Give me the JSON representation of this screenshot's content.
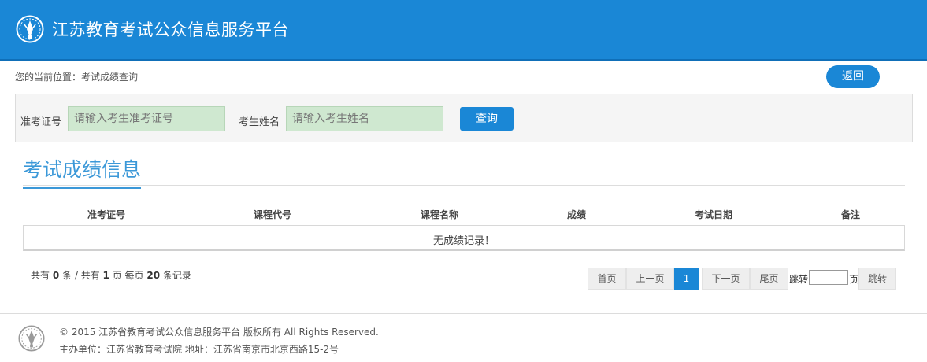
{
  "header": {
    "title": "江苏教育考试公众信息服务平台",
    "logo_icon": "emblem-icon",
    "color": "#1a87d6"
  },
  "breadcrumb": "您的当前位置：考试成绩查询",
  "back_label": "返回",
  "search": {
    "ticket_label": "准考证号",
    "ticket_placeholder": "请输入考生准考证号",
    "ticket_value": "",
    "name_label": "考生姓名",
    "name_placeholder": "请输入考生姓名",
    "name_value": "",
    "query_label": "查询"
  },
  "section_title": "考试成绩信息",
  "table": {
    "columns": [
      "准考证号",
      "课程代号",
      "课程名称",
      "成绩",
      "考试日期",
      "备注"
    ],
    "rows": [],
    "empty_message": "无成绩记录！"
  },
  "summary": {
    "prefix": "共有",
    "total_records": "0",
    "records_unit": "条 / 共有",
    "total_pages": "1",
    "pages_unit": "页 每页",
    "page_size": "20",
    "suffix": "条记录"
  },
  "pagination": {
    "first": "首页",
    "prev": "上一页",
    "current": "1",
    "next": "下一页",
    "last": "尾页",
    "jump_prefix": "跳转",
    "jump_suffix": "页",
    "jump_value": "",
    "jump_button": "跳转"
  },
  "footer": {
    "copyright": "© 2015 江苏省教育考试公众信息服务平台 版权所有 All Rights Reserved.",
    "organizer": "主办单位：江苏省教育考试院 地址：江苏省南京市北京西路15-2号",
    "logo_icon": "emblem-icon"
  }
}
